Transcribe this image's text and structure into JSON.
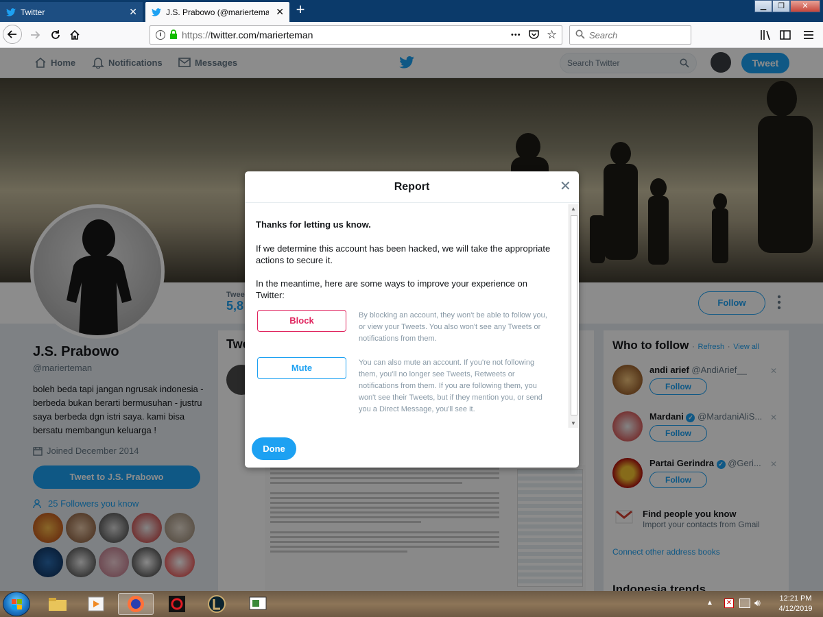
{
  "browser": {
    "tabs": [
      {
        "title": "Twitter",
        "active": false
      },
      {
        "title": "J.S. Prabowo (@marierteman) |",
        "active": true
      }
    ],
    "url_prefix": "https://",
    "url_host": "twitter.com/marierteman",
    "search_placeholder": "Search",
    "menu_dots": "•••"
  },
  "twitter": {
    "nav": {
      "home": "Home",
      "notifications": "Notifications",
      "messages": "Messages",
      "search_placeholder": "Search Twitter",
      "tweet_button": "Tweet"
    },
    "profile": {
      "name": "J.S. Prabowo",
      "handle": "@marierteman",
      "bio": "boleh beda tapi jangan ngrusak indonesia - berbeda bukan berarti bermusuhan - justru saya berbeda dgn istri saya. kami bisa bersatu membangun keluarga !",
      "joined": "Joined December 2014",
      "tweet_to": "Tweet to J.S. Prabowo",
      "followers_you_know": "25 Followers you know",
      "stat_label": "Twee",
      "stat_value": "5,8",
      "follow_button": "Follow"
    },
    "timeline": {
      "title": "Twe"
    },
    "who_to_follow": {
      "title": "Who to follow",
      "refresh": "Refresh",
      "view_all": "View all",
      "separator": "·",
      "users": [
        {
          "name": "andi arief",
          "handle": "@AndiArief__",
          "button": "Follow"
        },
        {
          "name": "Mardani",
          "handle": "@MardaniAliS...",
          "button": "Follow"
        },
        {
          "name": "Partai Gerindra",
          "handle": "@Geri...",
          "button": "Follow"
        }
      ],
      "find_people": "Find people you know",
      "find_people_sub": "Import your contacts from Gmail",
      "connect": "Connect other address books",
      "trends": "Indonesia trends"
    }
  },
  "modal": {
    "title": "Report",
    "thanks": "Thanks for letting us know.",
    "p1": "If we determine this account has been hacked, we will take the appropriate actions to secure it.",
    "p2": "In the meantime, here are some ways to improve your experience on Twitter:",
    "block_label": "Block",
    "block_desc": "By blocking an account, they won't be able to follow you, or view your Tweets. You also won't see any Tweets or notifications from them.",
    "mute_label": "Mute",
    "mute_desc": "You can also mute an account. If you're not following them, you'll no longer see Tweets, Retweets or notifications from them. If you are following them, you won't see their Tweets, but if they mention you, or send you a Direct Message, you'll see it.",
    "done": "Done"
  },
  "taskbar": {
    "time": "12:21 PM",
    "date": "4/12/2019"
  },
  "colors": {
    "twitter_blue": "#1da1f2",
    "block_red": "#e0245e",
    "tab_bar": "#0b3a6a"
  },
  "icons": [
    "twitter-bird-icon",
    "back-icon",
    "forward-icon",
    "reload-icon",
    "home-icon",
    "info-icon",
    "lock-icon",
    "pocket-icon",
    "star-icon",
    "search-icon",
    "library-icon",
    "sidebar-icon",
    "hamburger-icon",
    "bell-icon",
    "mail-icon",
    "calendar-icon",
    "people-icon",
    "close-icon"
  ]
}
